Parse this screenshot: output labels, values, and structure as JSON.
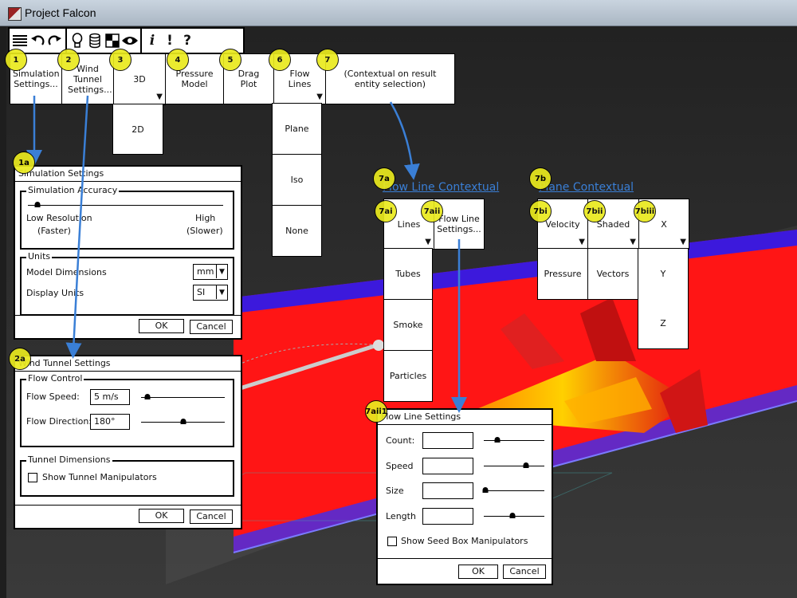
{
  "window": {
    "title": "Project Falcon"
  },
  "toolbar": {
    "icons": [
      "menu-icon",
      "undo-icon",
      "redo-icon",
      "lightbulb-icon",
      "database-icon",
      "checker-icon",
      "eye-icon",
      "info-icon",
      "alert-icon",
      "help-icon"
    ],
    "info_glyph": "i",
    "alert_glyph": "!",
    "help_glyph": "?"
  },
  "ribbon": {
    "sim_settings": "Simulation Settings...",
    "wind_tunnel": "Wind Tunnel Settings...",
    "view_3d": "3D",
    "view_2d": "2D",
    "pressure_model": "Pressure Model",
    "drag_plot": "Drag Plot",
    "flow_lines": "Flow Lines",
    "contextual": "(Contextual on result entity selection)"
  },
  "flow_lines_menu": [
    "Plane",
    "Iso",
    "None"
  ],
  "badges": {
    "b1": "1",
    "b2": "2",
    "b3": "3",
    "b4": "4",
    "b5": "5",
    "b6": "6",
    "b7": "7",
    "b1a": "1a",
    "b2a": "2a",
    "b7a": "7a",
    "b7b": "7b",
    "b7ai": "7ai",
    "b7aii": "7aii",
    "b7bi": "7bi",
    "b7bii": "7bii",
    "b7biii": "7biii",
    "b7aii1": "7aii1"
  },
  "sim_dialog": {
    "title": "Simulation Settings",
    "accuracy_group": "Simulation Accuracy",
    "low_label": "Low Resolution",
    "low_sub": "(Faster)",
    "high_label": "High",
    "high_sub": "(Slower)",
    "accuracy_value": 0.05,
    "units_group": "Units",
    "model_dims_label": "Model Dimensions",
    "model_dims_value": "mm",
    "display_units_label": "Display Units",
    "display_units_value": "SI",
    "ok": "OK",
    "cancel": "Cancel"
  },
  "wind_dialog": {
    "title": "Wind Tunnel Settings",
    "flow_group": "Flow Control",
    "speed_label": "Flow Speed:",
    "speed_value": "5 m/s",
    "speed_slider": 0.08,
    "direction_label": "Flow Direction:",
    "direction_value": "180°",
    "direction_slider": 0.5,
    "tunnel_group": "Tunnel Dimensions",
    "manip_label": "Show Tunnel Manipulators",
    "ok": "OK",
    "cancel": "Cancel"
  },
  "flow_ctx": {
    "heading": "Flow Line Contextual",
    "lines": "Lines",
    "settings": "Flow Line Settings...",
    "menu": [
      "Tubes",
      "Smoke",
      "Particles"
    ]
  },
  "plane_ctx": {
    "heading": "Plane Contextual",
    "velocity": "Velocity",
    "shaded": "Shaded",
    "x": "X",
    "pressure": "Pressure",
    "vectors": "Vectors",
    "y": "Y",
    "z": "Z"
  },
  "flow_dialog": {
    "title": "Flow Line Settings",
    "count_label": "Count:",
    "count_slider": 0.22,
    "speed_label": "Speed",
    "speed_slider": 0.7,
    "size_label": "Size",
    "size_slider": 0.02,
    "length_label": "Length",
    "length_slider": 0.48,
    "seed_label": "Show Seed Box Manipulators",
    "ok": "OK",
    "cancel": "Cancel"
  },
  "colors": {
    "accent_link": "#3a7fd6",
    "badge": "#eaea1e",
    "plane_red": "#ff1a1a",
    "plane_blue": "#1a1aff"
  }
}
